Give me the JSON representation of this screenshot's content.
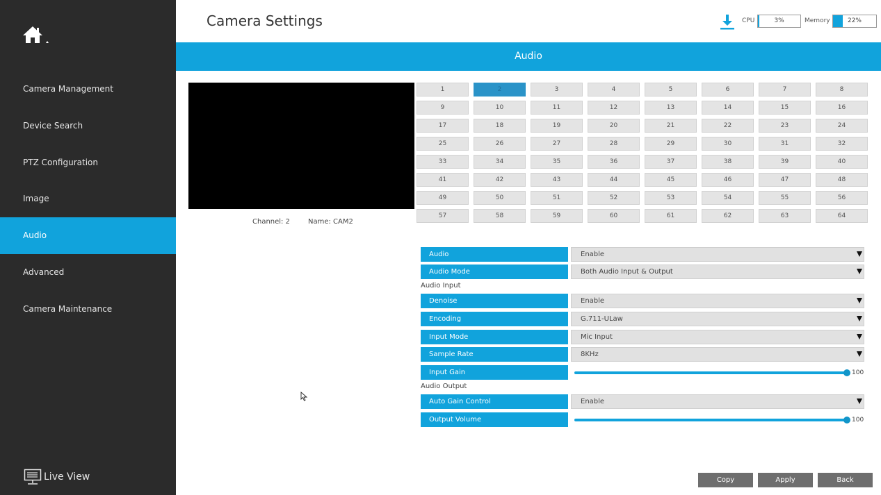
{
  "sidebar": {
    "items": [
      {
        "label": "Camera Management"
      },
      {
        "label": "Device Search"
      },
      {
        "label": "PTZ Configuration"
      },
      {
        "label": "Image"
      },
      {
        "label": "Audio",
        "active": true
      },
      {
        "label": "Advanced"
      },
      {
        "label": "Camera Maintenance"
      }
    ],
    "live_view_label": "Live View"
  },
  "header": {
    "title": "Camera Settings",
    "cpu_label": "CPU",
    "cpu_value": "3%",
    "cpu_percent": 3,
    "memory_label": "Memory",
    "memory_value": "22%",
    "memory_percent": 22
  },
  "banner": {
    "title": "Audio"
  },
  "preview": {
    "channel_text": "Channel: 2",
    "name_text": "Name: CAM2"
  },
  "channels": {
    "selected": 2,
    "labels": [
      "1",
      "2",
      "3",
      "4",
      "5",
      "6",
      "7",
      "8",
      "9",
      "10",
      "11",
      "12",
      "13",
      "14",
      "15",
      "16",
      "17",
      "18",
      "19",
      "20",
      "21",
      "22",
      "23",
      "24",
      "25",
      "26",
      "27",
      "28",
      "29",
      "30",
      "31",
      "32",
      "33",
      "34",
      "35",
      "36",
      "37",
      "38",
      "39",
      "40",
      "41",
      "42",
      "43",
      "44",
      "45",
      "46",
      "47",
      "48",
      "49",
      "50",
      "51",
      "52",
      "53",
      "54",
      "55",
      "56",
      "57",
      "58",
      "59",
      "60",
      "61",
      "62",
      "63",
      "64"
    ]
  },
  "form": {
    "audio": {
      "label": "Audio",
      "value": "Enable"
    },
    "audio_mode": {
      "label": "Audio Mode",
      "value": "Both Audio Input & Output"
    },
    "audio_input_section": "Audio Input",
    "denoise": {
      "label": "Denoise",
      "value": "Enable"
    },
    "encoding": {
      "label": "Encoding",
      "value": "G.711-ULaw"
    },
    "input_mode": {
      "label": "Input Mode",
      "value": "Mic Input"
    },
    "sample_rate": {
      "label": "Sample Rate",
      "value": "8KHz"
    },
    "input_gain": {
      "label": "Input Gain",
      "value": "100",
      "level": 100
    },
    "audio_output_section": "Audio Output",
    "auto_gain_control": {
      "label": "Auto Gain Control",
      "value": "Enable"
    },
    "output_volume": {
      "label": "Output Volume",
      "value": "100",
      "level": 100
    }
  },
  "footer": {
    "copy_label": "Copy",
    "apply_label": "Apply",
    "back_label": "Back"
  },
  "colors": {
    "accent": "#11a3dc",
    "sidebar": "#2b2b2b",
    "selected_channel": "#2a93c8",
    "footer_button": "#6e6e6e"
  },
  "icons": [
    "home-icon",
    "live-view-icon",
    "download-icon",
    "dropdown-caret-icon",
    "cursor-icon"
  ]
}
